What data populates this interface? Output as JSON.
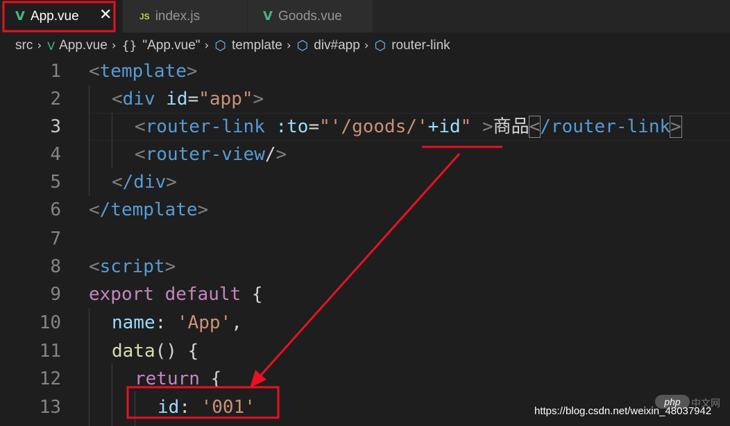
{
  "tabs": [
    {
      "label": "App.vue",
      "icon": "vue-icon",
      "active": true,
      "close": "✕"
    },
    {
      "label": "index.js",
      "icon": "js-icon",
      "icon_text": "JS",
      "active": false
    },
    {
      "label": "Goods.vue",
      "icon": "vue-icon",
      "active": false
    }
  ],
  "breadcrumb": {
    "src": "src",
    "file": "App.vue",
    "braces": "{}",
    "component": "\"App.vue\"",
    "template": "template",
    "div": "div#app",
    "link": "router-link"
  },
  "lines": {
    "l1": "1",
    "l2": "2",
    "l3": "3",
    "l4": "4",
    "l5": "5",
    "l6": "6",
    "l7": "7",
    "l8": "8",
    "l9": "9",
    "l10": "10",
    "l11": "11",
    "l12": "12",
    "l13": "13"
  },
  "code": {
    "template_tag": "template",
    "div_tag": "div",
    "div_attr": "id",
    "div_val": "\"app\"",
    "router_link": "router-link",
    "to_attr": ":to",
    "to_q1": "\"",
    "to_str": "'/goods/'",
    "to_expr": "+id",
    "to_q2": "\"",
    "link_text": "商品",
    "router_link_close": "/router-link",
    "router_view": "router-view",
    "div_close": "/div",
    "template_close": "/template",
    "script_tag": "script",
    "export": "export",
    "default": "default",
    "open_brace": "{",
    "name_key": "name",
    "name_val": "'App'",
    "data_fn": "data",
    "data_rest": "() {",
    "return": "return",
    "return_brace": "{",
    "id_key": "id",
    "id_val": "'001'"
  },
  "watermark": {
    "url": "https://blog.csdn.net/weixin_48037942",
    "logo": "php",
    "cn": "中文网"
  },
  "colors": {
    "annotation": "#e81123",
    "vue_green": "#41b883",
    "tag_blue": "#569cd6",
    "string_orange": "#ce9178"
  }
}
